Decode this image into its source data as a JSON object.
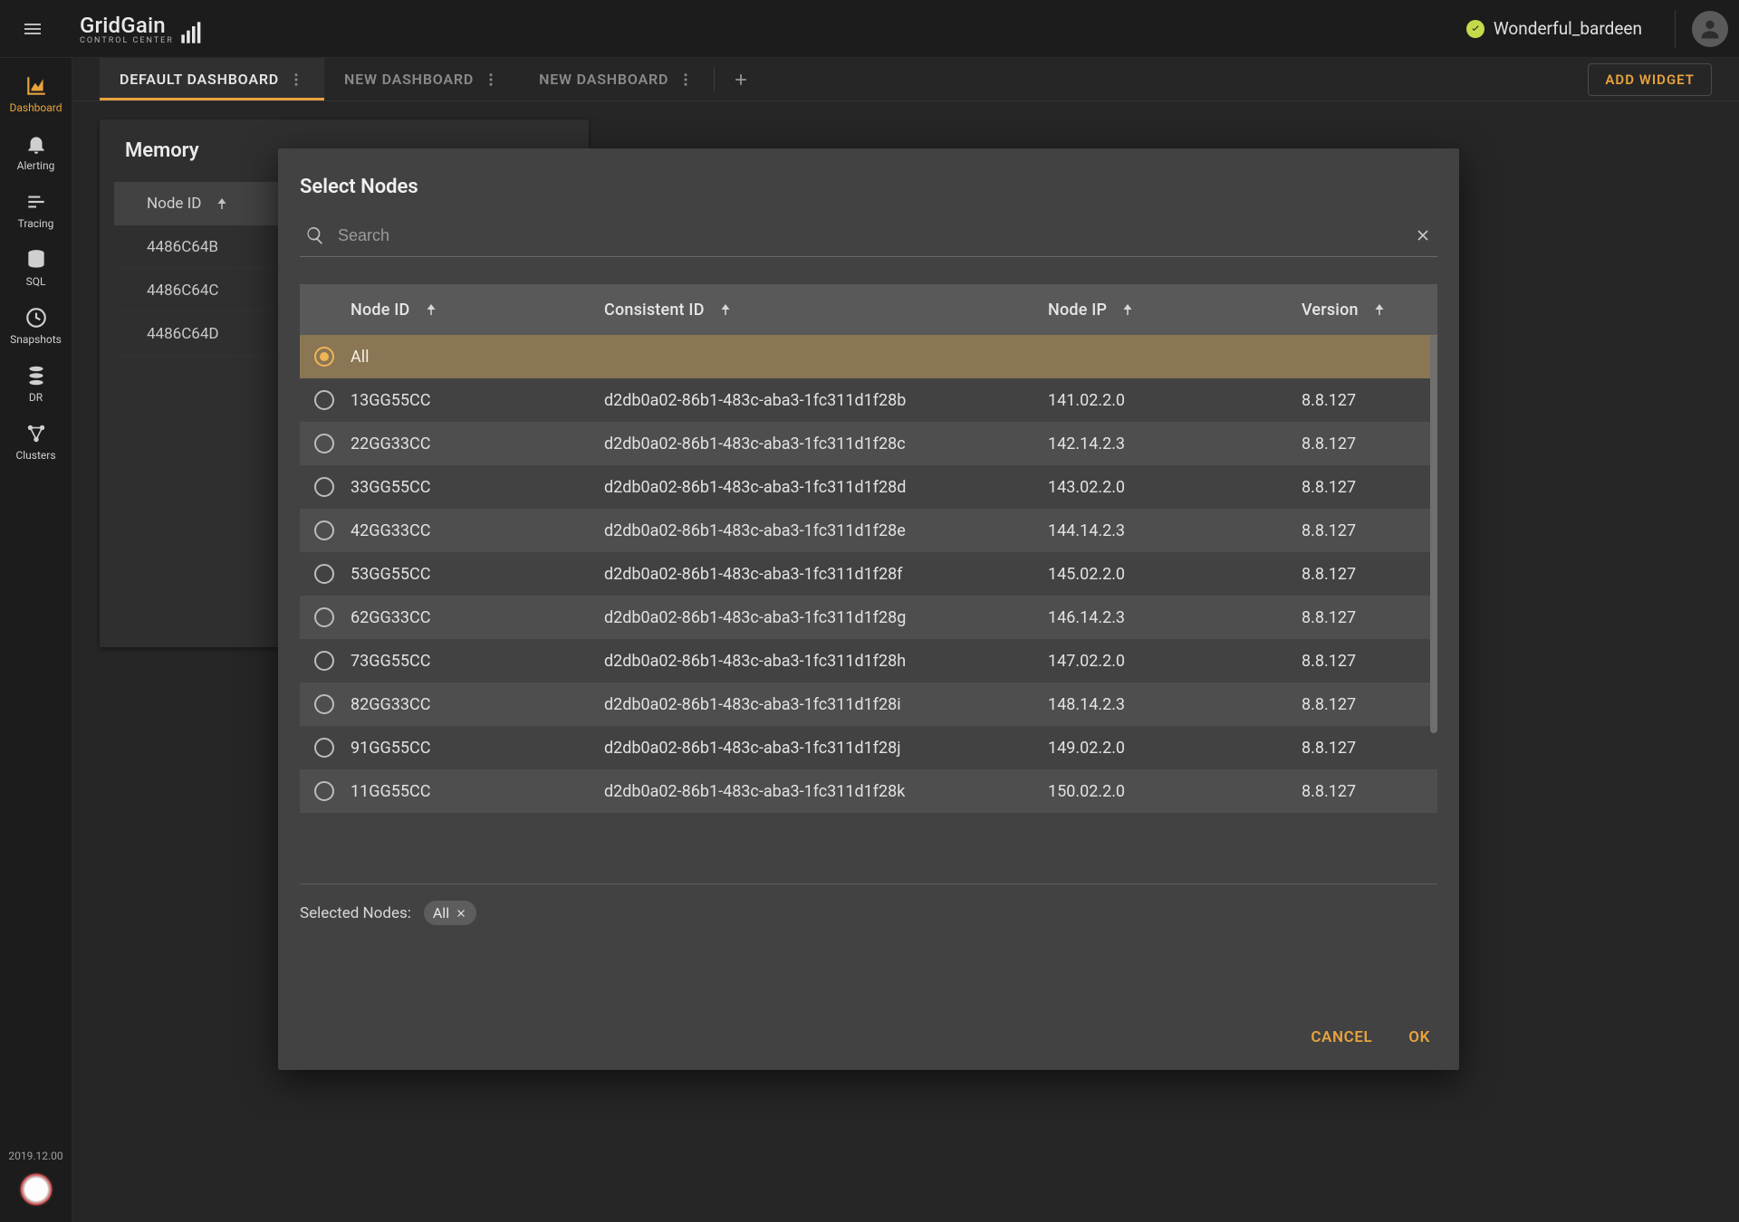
{
  "header": {
    "product_name": "GridGain",
    "product_subtitle": "CONTROL CENTER",
    "username": "Wonderful_bardeen"
  },
  "nav": {
    "items": [
      {
        "label": "Dashboard",
        "icon": "chart-area-icon",
        "active": true
      },
      {
        "label": "Alerting",
        "icon": "bell-icon"
      },
      {
        "label": "Tracing",
        "icon": "bars-icon"
      },
      {
        "label": "SQL",
        "icon": "database-icon"
      },
      {
        "label": "Snapshots",
        "icon": "clock-icon"
      },
      {
        "label": "DR",
        "icon": "database-stack-icon"
      },
      {
        "label": "Clusters",
        "icon": "cluster-icon"
      }
    ],
    "version": "2019.12.00"
  },
  "tabs": {
    "list": [
      {
        "label": "DEFAULT DASHBOARD",
        "active": true
      },
      {
        "label": "NEW DASHBOARD"
      },
      {
        "label": "NEW DASHBOARD"
      }
    ],
    "add_widget": "ADD WIDGET"
  },
  "memory_widget": {
    "title": "Memory",
    "head": "Node ID",
    "rows": [
      "4486C64B",
      "4486C64C",
      "4486C64D"
    ]
  },
  "modal": {
    "title": "Select Nodes",
    "search_placeholder": "Search",
    "columns": {
      "node_id": "Node ID",
      "consistent_id": "Consistent ID",
      "node_ip": "Node IP",
      "version": "Version"
    },
    "all_label": "All",
    "rows": [
      {
        "nid": "13GG55CC",
        "cid": "d2db0a02-86b1-483c-aba3-1fc311d1f28b",
        "ip": "141.02.2.0",
        "ver": "8.8.127"
      },
      {
        "nid": "22GG33CC",
        "cid": "d2db0a02-86b1-483c-aba3-1fc311d1f28c",
        "ip": "142.14.2.3",
        "ver": "8.8.127"
      },
      {
        "nid": "33GG55CC",
        "cid": "d2db0a02-86b1-483c-aba3-1fc311d1f28d",
        "ip": "143.02.2.0",
        "ver": "8.8.127"
      },
      {
        "nid": "42GG33CC",
        "cid": "d2db0a02-86b1-483c-aba3-1fc311d1f28e",
        "ip": "144.14.2.3",
        "ver": "8.8.127"
      },
      {
        "nid": "53GG55CC",
        "cid": "d2db0a02-86b1-483c-aba3-1fc311d1f28f",
        "ip": "145.02.2.0",
        "ver": "8.8.127"
      },
      {
        "nid": "62GG33CC",
        "cid": "d2db0a02-86b1-483c-aba3-1fc311d1f28g",
        "ip": "146.14.2.3",
        "ver": "8.8.127"
      },
      {
        "nid": "73GG55CC",
        "cid": "d2db0a02-86b1-483c-aba3-1fc311d1f28h",
        "ip": "147.02.2.0",
        "ver": "8.8.127"
      },
      {
        "nid": "82GG33CC",
        "cid": "d2db0a02-86b1-483c-aba3-1fc311d1f28i",
        "ip": "148.14.2.3",
        "ver": "8.8.127"
      },
      {
        "nid": "91GG55CC",
        "cid": "d2db0a02-86b1-483c-aba3-1fc311d1f28j",
        "ip": "149.02.2.0",
        "ver": "8.8.127"
      },
      {
        "nid": "11GG55CC",
        "cid": "d2db0a02-86b1-483c-aba3-1fc311d1f28k",
        "ip": "150.02.2.0",
        "ver": "8.8.127"
      }
    ],
    "selected_label": "Selected Nodes:",
    "selected_chip": "All",
    "cancel": "CANCEL",
    "ok": "OK"
  }
}
